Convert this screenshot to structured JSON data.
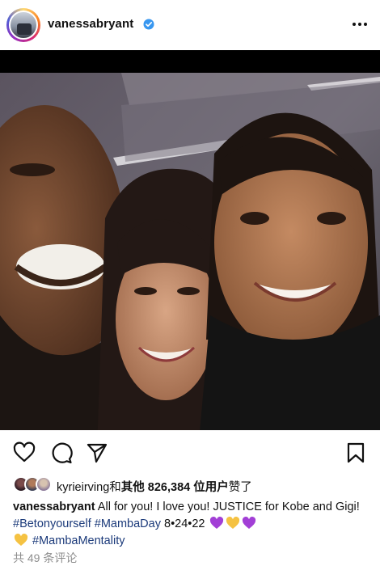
{
  "post": {
    "username": "vanessabryant",
    "verified": true,
    "more_icon": "more-horizontal-icon"
  },
  "actions": {
    "like_icon": "heart-outline-icon",
    "comment_icon": "comment-bubble-icon",
    "share_icon": "paper-plane-icon",
    "save_icon": "bookmark-icon"
  },
  "likes": {
    "first_liker": "kyrieirving",
    "connector": "和",
    "others_label": "其他 826,384 位用户",
    "suffix": "赞了"
  },
  "caption": {
    "username": "vanessabryant",
    "text1": "All for you! I love you! JUSTICE for Kobe and Gigi!",
    "tag1": "#Betonyourself",
    "tag2": "#MambaDay",
    "date": "8•24•22",
    "tag3": "#MambaMentality",
    "emojis": [
      "purple-heart",
      "yellow-heart",
      "purple-heart",
      "yellow-heart"
    ]
  },
  "comments": {
    "label": "共 49 条评论"
  },
  "colors": {
    "verified_blue": "#3897f0",
    "purple_heart": "#a23fd6",
    "yellow_heart": "#f5c242",
    "hashtag": "#1b3a7a",
    "muted": "#8e8e8e"
  }
}
